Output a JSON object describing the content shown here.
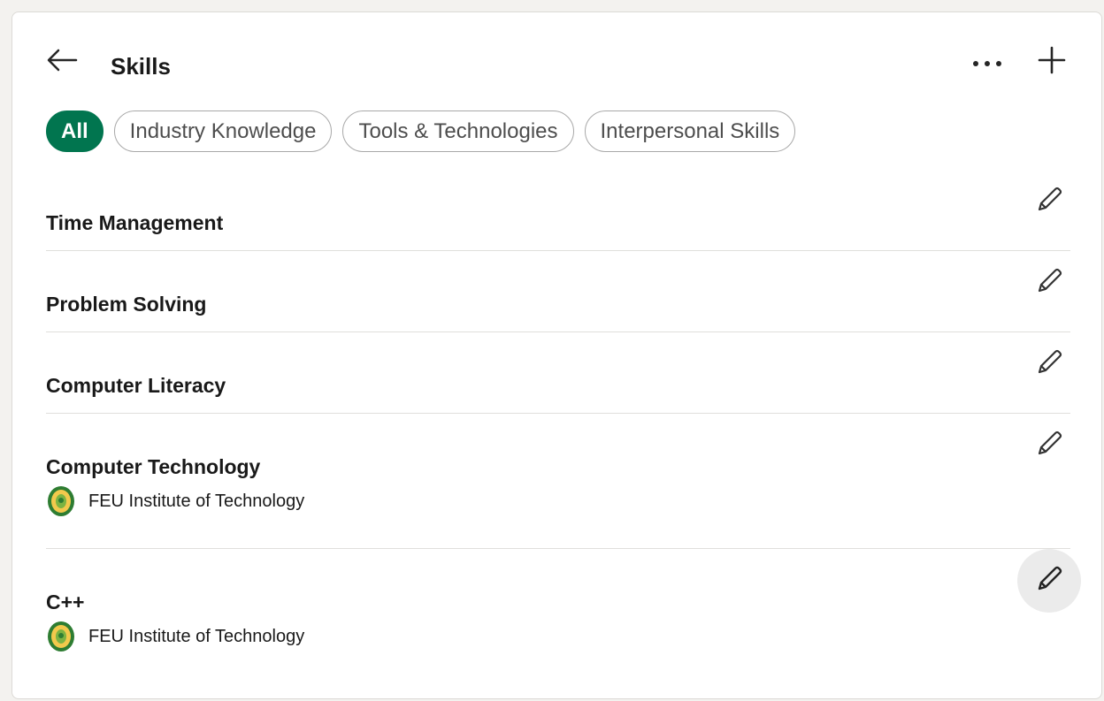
{
  "header": {
    "title": "Skills"
  },
  "filters": [
    {
      "label": "All",
      "active": true
    },
    {
      "label": "Industry Knowledge",
      "active": false
    },
    {
      "label": "Tools & Technologies",
      "active": false
    },
    {
      "label": "Interpersonal Skills",
      "active": false
    }
  ],
  "skills": [
    {
      "name": "Time Management"
    },
    {
      "name": "Problem Solving"
    },
    {
      "name": "Computer Literacy"
    },
    {
      "name": "Computer Technology",
      "source": "FEU Institute of Technology"
    },
    {
      "name": "C++",
      "source": "FEU Institute of Technology"
    }
  ],
  "icons": {
    "back": "arrow-left-icon",
    "more": "more-horizontal-icon",
    "add": "plus-icon",
    "edit": "pencil-icon",
    "school": "feu-logo-icon"
  },
  "colors": {
    "accent": "#01754f",
    "school_logo_green": "#2e7d32",
    "school_logo_gold": "#f2c94c"
  }
}
